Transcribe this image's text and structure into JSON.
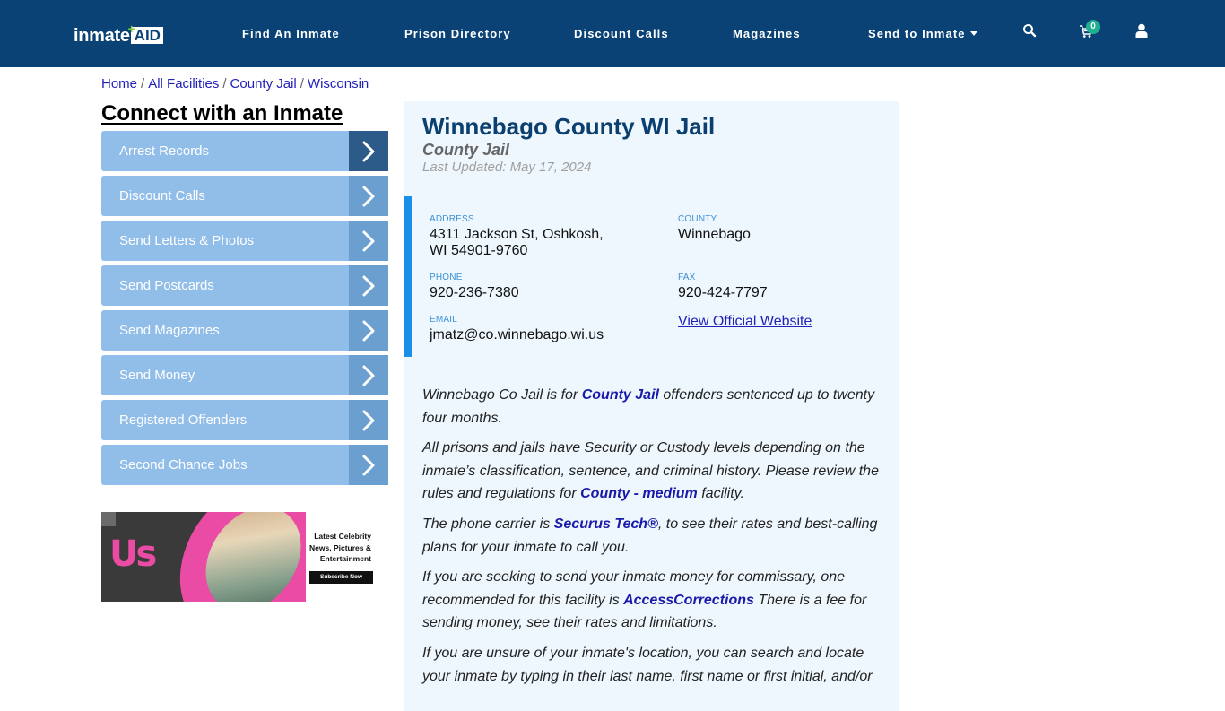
{
  "navbar": {
    "logo": {
      "text_main": "inmate",
      "text_accent": "AID",
      "plus": "+"
    },
    "links": [
      {
        "label": "Find An Inmate"
      },
      {
        "label": "Prison Directory"
      },
      {
        "label": "Discount Calls"
      },
      {
        "label": "Magazines"
      },
      {
        "label": "Send to Inmate",
        "has_dropdown": true
      }
    ],
    "icons": {
      "search": "search-icon",
      "cart": "cart-icon",
      "user": "user-icon"
    },
    "cart_count": "0",
    "colors": {
      "background": "#0a4275",
      "badge": "#1fb18f"
    }
  },
  "breadcrumb": [
    {
      "label": "Home"
    },
    {
      "label": "All Facilities"
    },
    {
      "label": "County Jail"
    },
    {
      "label": "Wisconsin"
    }
  ],
  "breadcrumb_separator": "/",
  "sidebar": {
    "title": "Connect with an Inmate",
    "items": [
      {
        "label": "Arrest Records",
        "active": true
      },
      {
        "label": "Discount Calls"
      },
      {
        "label": "Send Letters & Photos"
      },
      {
        "label": "Send Postcards"
      },
      {
        "label": "Send Magazines"
      },
      {
        "label": "Send Money"
      },
      {
        "label": "Registered Offenders"
      },
      {
        "label": "Second Chance Jobs"
      }
    ],
    "ad": {
      "brand": "Us",
      "headline": "Latest Celebrity News, Pictures & Entertainment",
      "cta": "Subscribe Now"
    }
  },
  "facility": {
    "name": "Winnebago County WI Jail",
    "type": "County Jail",
    "last_updated": "Last Updated: May 17, 2024",
    "fields": {
      "address_label": "ADDRESS",
      "address_line1": "4311 Jackson St, Oshkosh,",
      "address_line2": "WI 54901-9760",
      "county_label": "COUNTY",
      "county": "Winnebago",
      "phone_label": "PHONE",
      "phone": "920-236-7380",
      "fax_label": "FAX",
      "fax": "920-424-7797",
      "email_label": "EMAIL",
      "email": "jmatz@co.winnebago.wi.us",
      "website_link": "View Official Website"
    },
    "paragraphs": {
      "p1": {
        "before": "Winnebago Co Jail is for ",
        "link": "County Jail",
        "after": " offenders sentenced up to twenty four months."
      },
      "p2": {
        "before": "All prisons and jails have Security or Custody levels depending on the inmate’s classification, sentence, and criminal history. Please review the rules and regulations for ",
        "link": "County - medium",
        "after": " facility."
      },
      "p3": {
        "before": "The phone carrier is ",
        "link": "Securus Tech®",
        "after": ", to see their rates and best-calling plans for your inmate to call you."
      },
      "p4": {
        "before": "If you are seeking to send your inmate money for commissary, one recommended for this facility is ",
        "link": "AccessCorrections",
        "after": " There is a fee for sending money, see their rates and limitations."
      },
      "p5": {
        "before": "If you are unsure of your inmate's location, you can search and locate your inmate by typing in their last name, first name or first initial, and/or"
      }
    }
  }
}
